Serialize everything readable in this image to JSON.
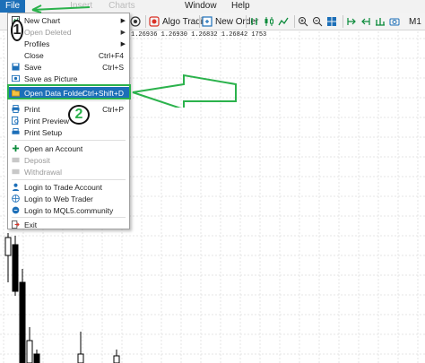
{
  "menubar": {
    "items": [
      {
        "label": "File"
      },
      {
        "label": "Insert"
      },
      {
        "label": "Charts"
      },
      {
        "label": "Window"
      },
      {
        "label": "Help"
      }
    ]
  },
  "toolbar": {
    "algo_trading": "Algo Trading",
    "new_order": "New Order",
    "timeframe": "M1"
  },
  "chart": {
    "ohlc_text": "1.26936 1.26930 1.26832 1.26842  1753"
  },
  "file_menu": {
    "items": [
      {
        "label": "New Chart",
        "shortcut": "",
        "submenu": true,
        "disabled": false
      },
      {
        "label": "Open Deleted",
        "shortcut": "",
        "submenu": true,
        "disabled": true
      },
      {
        "label": "Profiles",
        "shortcut": "",
        "submenu": true,
        "disabled": false
      },
      {
        "label": "Close",
        "shortcut": "Ctrl+F4",
        "disabled": false
      },
      {
        "label": "Save",
        "shortcut": "Ctrl+S",
        "disabled": false
      },
      {
        "label": "Save as Picture",
        "shortcut": "",
        "disabled": false
      },
      {
        "label": "Open Data Folder",
        "shortcut": "Ctrl+Shift+D",
        "disabled": false,
        "highlighted": true
      },
      {
        "label": "Print",
        "shortcut": "Ctrl+P",
        "disabled": false
      },
      {
        "label": "Print Preview",
        "shortcut": "",
        "disabled": false
      },
      {
        "label": "Print Setup",
        "shortcut": "",
        "disabled": false
      },
      {
        "label": "Open an Account",
        "shortcut": "",
        "disabled": false
      },
      {
        "label": "Deposit",
        "shortcut": "",
        "disabled": true
      },
      {
        "label": "Withdrawal",
        "shortcut": "",
        "disabled": true
      },
      {
        "label": "Login to Trade Account",
        "shortcut": "",
        "disabled": false
      },
      {
        "label": "Login to Web Trader",
        "shortcut": "",
        "disabled": false
      },
      {
        "label": "Login to MQL5.community",
        "shortcut": "",
        "disabled": false
      },
      {
        "label": "Exit",
        "shortcut": "",
        "disabled": false
      }
    ]
  },
  "annotations": {
    "step1": "1",
    "step2": "2"
  },
  "colors": {
    "highlight": "#1c6fb8",
    "annotation_green": "#2bb24c",
    "grid": "#e4e4e4"
  }
}
